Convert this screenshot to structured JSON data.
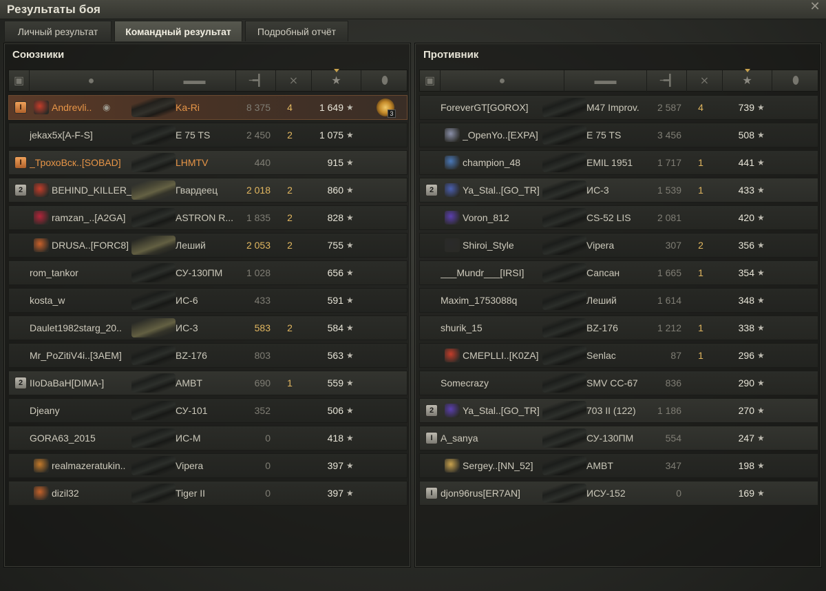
{
  "window": {
    "title": "Результаты боя",
    "close_icon": "close-icon"
  },
  "tabs": [
    {
      "label": "Личный результат",
      "active": false
    },
    {
      "label": "Командный результат",
      "active": true
    },
    {
      "label": "Подробный отчёт",
      "active": false
    }
  ],
  "allies": {
    "title": "Союзники",
    "rows": [
      {
        "badge": "I",
        "badge_color": "orange",
        "clan_color": "#c43d2a",
        "name": "Andrevli..",
        "vehicle": "Ka-Ri",
        "damage": "8 375",
        "kills": "4",
        "xp": "1 649",
        "highlight": "me",
        "medal": "3",
        "eye": true
      },
      {
        "badge": "",
        "name": "jekax5x[A-F-S]",
        "vehicle": "E 75 TS",
        "damage": "2 450",
        "kills": "2",
        "xp": "1 075"
      },
      {
        "badge": "I",
        "badge_color": "orange",
        "name": "_ТрохоВск..[SOBAD]",
        "vehicle": "LHMTV",
        "damage": "440",
        "kills": "",
        "xp": "915",
        "orange": true
      },
      {
        "badge": "2",
        "clan_color": "#c43d2a",
        "name": "BEHIND_KILLER_",
        "vehicle": "Гвардеец",
        "damage": "2 018",
        "dmg_hi": true,
        "kills": "2",
        "xp": "860",
        "lit": true
      },
      {
        "badge": "",
        "clan_color": "#b3243a",
        "name": "ramzan_..[A2GA]",
        "vehicle": "ASTRON R...",
        "damage": "1 835",
        "kills": "2",
        "xp": "828"
      },
      {
        "badge": "",
        "clan_color": "#c9612a",
        "name": "DRUSA..[FORC8]",
        "vehicle": "Леший",
        "damage": "2 053",
        "dmg_hi": true,
        "kills": "2",
        "xp": "755",
        "lit": true
      },
      {
        "badge": "",
        "name": "rom_tankor",
        "vehicle": "СУ-130ПМ",
        "damage": "1 028",
        "kills": "",
        "xp": "656"
      },
      {
        "badge": "",
        "name": "kosta_w",
        "vehicle": "ИС-6",
        "damage": "433",
        "kills": "",
        "xp": "591"
      },
      {
        "badge": "",
        "name": "Daulet1982starg_20..",
        "vehicle": "ИС-3",
        "damage": "583",
        "dmg_hi": true,
        "kills": "2",
        "xp": "584",
        "lit": true
      },
      {
        "badge": "",
        "name": "Mr_PoZitiV4i..[3AEM]",
        "vehicle": "BZ-176",
        "damage": "803",
        "kills": "",
        "xp": "563"
      },
      {
        "badge": "2",
        "name": "IIoDaBaH[DIMA-]",
        "vehicle": "AMBT",
        "damage": "690",
        "kills": "1",
        "xp": "559"
      },
      {
        "badge": "",
        "name": "Djeany",
        "vehicle": "СУ-101",
        "damage": "352",
        "kills": "",
        "xp": "506"
      },
      {
        "badge": "",
        "name": "GORA63_2015",
        "vehicle": "ИС-М",
        "damage": "0",
        "kills": "",
        "xp": "418"
      },
      {
        "badge": "",
        "clan_color": "#c47a2a",
        "name": "realmazeratukin..",
        "vehicle": "Vipera",
        "damage": "0",
        "kills": "",
        "xp": "397"
      },
      {
        "badge": "",
        "clan_color": "#c4622a",
        "name": "dizil32",
        "vehicle": "Tiger II",
        "damage": "0",
        "kills": "",
        "xp": "397"
      }
    ]
  },
  "enemies": {
    "title": "Противник",
    "rows": [
      {
        "badge": "",
        "name": "ForeverGT[GOROX]",
        "vehicle": "M47 Improv.",
        "damage": "2 587",
        "kills": "4",
        "xp": "739"
      },
      {
        "badge": "",
        "clan_color": "#8a8fa8",
        "name": "_OpenYo..[EXPA]",
        "vehicle": "E 75 TS",
        "damage": "3 456",
        "kills": "",
        "xp": "508"
      },
      {
        "badge": "",
        "clan_color": "#4a78b8",
        "name": "champion_48",
        "vehicle": "EMIL 1951",
        "damage": "1 717",
        "kills": "1",
        "xp": "441"
      },
      {
        "badge": "2",
        "clan_color": "#4a5fb0",
        "name": "Ya_Stal..[GO_TR]",
        "vehicle": "ИС-3",
        "damage": "1 539",
        "kills": "1",
        "xp": "433"
      },
      {
        "badge": "",
        "clan_color": "#5b3fb0",
        "name": "Voron_812",
        "vehicle": "CS-52 LIS",
        "damage": "2 081",
        "kills": "",
        "xp": "420"
      },
      {
        "badge": "",
        "clan_color": "#2a2a2a",
        "name": "Shiroi_Style",
        "vehicle": "Vipera",
        "damage": "307",
        "kills": "2",
        "xp": "356"
      },
      {
        "badge": "",
        "name": "___Mundr___[IRSI]",
        "vehicle": "Сапсан",
        "damage": "1 665",
        "kills": "1",
        "xp": "354"
      },
      {
        "badge": "",
        "name": "Maxim_1753088q",
        "vehicle": "Леший",
        "damage": "1 614",
        "kills": "",
        "xp": "348"
      },
      {
        "badge": "",
        "name": "shurik_15",
        "vehicle": "BZ-176",
        "damage": "1 212",
        "kills": "1",
        "xp": "338"
      },
      {
        "badge": "",
        "clan_color": "#c43d2a",
        "name": "CMEPLLI..[K0ZA]",
        "vehicle": "Senlac",
        "damage": "87",
        "kills": "1",
        "xp": "296"
      },
      {
        "badge": "",
        "name": "Somecrazy",
        "vehicle": "SMV CC-67",
        "damage": "836",
        "kills": "",
        "xp": "290"
      },
      {
        "badge": "2",
        "clan_color": "#5b3fb0",
        "name": "Ya_Stal..[GO_TR]",
        "vehicle": "703 II (122)",
        "damage": "1 186",
        "kills": "",
        "xp": "270"
      },
      {
        "badge": "I",
        "name": "A_sanya",
        "vehicle": "СУ-130ПМ",
        "damage": "554",
        "kills": "",
        "xp": "247"
      },
      {
        "badge": "",
        "clan_color": "#c9a24d",
        "name": "Sergey..[NN_52]",
        "vehicle": "AMBT",
        "damage": "347",
        "kills": "",
        "xp": "198"
      },
      {
        "badge": "I",
        "name": "djon96rus[ER7AN]",
        "vehicle": "ИСУ-152",
        "damage": "0",
        "kills": "",
        "xp": "169"
      }
    ]
  },
  "columns": {
    "platoon": "platoon-icon",
    "player": "player-icon",
    "vehicle": "tank-icon",
    "damage": "damage-icon",
    "kills": "kills-icon",
    "xp": "xp-star-icon",
    "medals": "medal-icon"
  },
  "colors": {
    "accent": "#e79547",
    "highlight_value": "#e2b760",
    "sort_arrow": "#c9a24d"
  }
}
